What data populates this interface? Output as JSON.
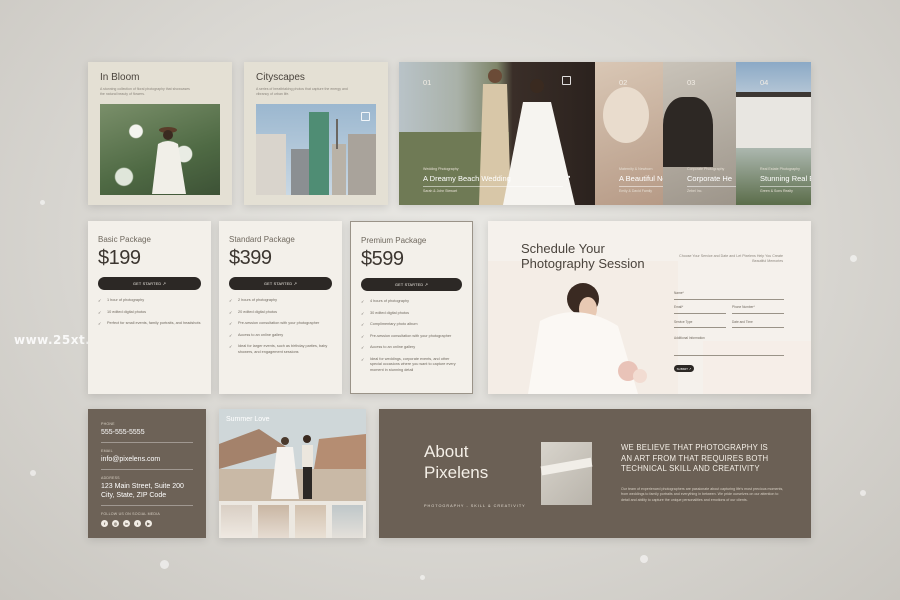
{
  "watermark": "www.25xt.com",
  "gallery": [
    {
      "title": "In Bloom",
      "desc": "A stunning collection of floral photography that showcases the natural beauty of flowers."
    },
    {
      "title": "Cityscapes",
      "desc": "A series of breathtaking photos that capture the energy and vibrancy of urban life."
    }
  ],
  "strip": [
    {
      "num": "01",
      "cat": "Wedding Photography",
      "title": "A Dreamy Beach Wedding",
      "who": "Sarah & John Stewart"
    },
    {
      "num": "02",
      "cat": "Maternity & Newborn",
      "title": "A Beautiful Ne",
      "who": "Emily & David Family"
    },
    {
      "num": "03",
      "cat": "Corporate Photography",
      "title": "Corporate He",
      "who": "Zebel Inc."
    },
    {
      "num": "04",
      "cat": "Real Estate Photography",
      "title": "Stunning Real E",
      "who": "Green & Sons Realty"
    }
  ],
  "pricing": [
    {
      "name": "Basic Package",
      "price": "$199",
      "button": "GET STARTED ↗",
      "features": [
        "1 hour of photography",
        "10 edited digital photos",
        "Perfect for small events, family portraits, and headshots"
      ]
    },
    {
      "name": "Standard Package",
      "price": "$399",
      "button": "GET STARTED ↗",
      "features": [
        "2 hours of photography",
        "20 edited digital photos",
        "Pre-session consultation with your photographer",
        "Access to an online gallery",
        "Ideal for larger events, such as birthday parties, baby showers, and engagement sessions"
      ]
    },
    {
      "name": "Premium Package",
      "price": "$599",
      "button": "GET STARTED ↗",
      "features": [
        "4 hours of photography",
        "30 edited digital photos",
        "Complimentary photo album",
        "Pre-session consultation with your photographer",
        "Access to an online gallery",
        "Ideal for weddings, corporate events, and other special occasions where you want to capture every moment in stunning detail"
      ]
    }
  ],
  "schedule": {
    "title": "Schedule Your Photography Session",
    "subtitle": "Choose Your Service and Date and Let Pixelens Help You Create Beautiful Memories",
    "fields": {
      "name": "Name*",
      "email": "Email*",
      "phone": "Phone Number*",
      "service": "Service Type",
      "date": "Date and Time",
      "info": "Additional Information"
    },
    "submit": "SUBMIT ↗"
  },
  "contact": {
    "phone_label": "PHONE",
    "phone": "555-555-5555",
    "email_label": "EMAIL",
    "email": "info@pixelens.com",
    "address_label": "ADDRESS",
    "address": "123 Main Street, Suite 200 City, State, ZIP Code",
    "social_label": "FOLLOW US ON SOCIAL MEDIA",
    "socials": [
      "f",
      "◎",
      "in",
      "t",
      "▶"
    ]
  },
  "summer": {
    "title": "Summer Love"
  },
  "about": {
    "title": "About Pixelens",
    "tagline": "PHOTOGRAPHY - SKILL & CREATIVITY",
    "headline": "WE BELIEVE THAT PHOTOGRAPHY IS AN ART FROM THAT REQUIRES BOTH TECHNICAL SKILL AND CREATIVITY",
    "body": "Our team of experienced photographers are passionate about capturing life's most precious moments, from weddings to family portraits and everything in between. We pride ourselves on our attention to detail and ability to capture the unique personalities and emotions of our clients."
  }
}
